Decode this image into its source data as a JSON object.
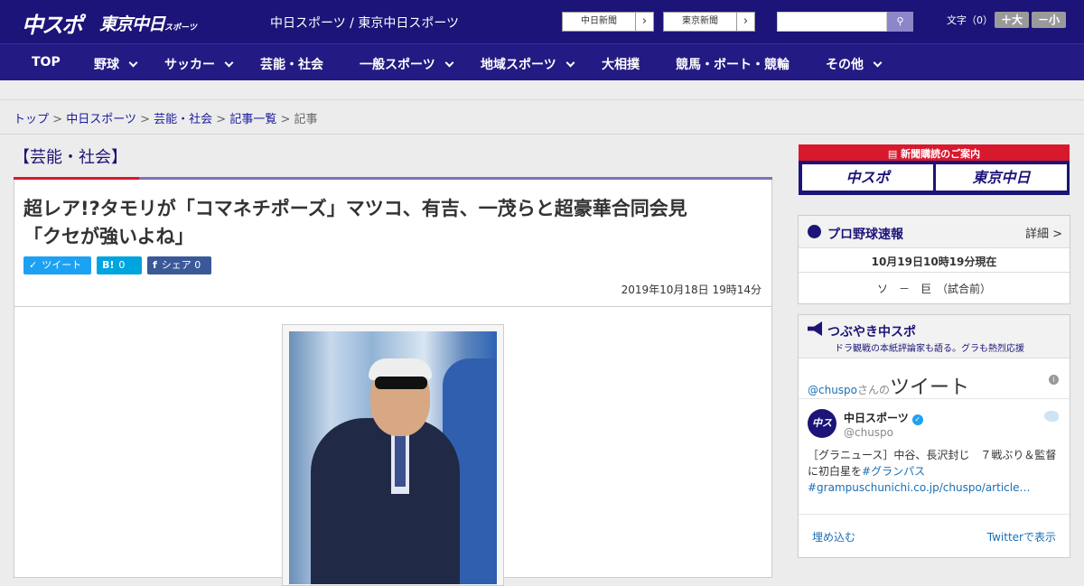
{
  "header": {
    "logo_main": "中スポ",
    "logo_tokyo": "東京中日",
    "logo_tokyo_suffix": "スポーツ",
    "site_title": "中日スポーツ / 東京中日スポーツ",
    "btn_chunichi": "中日新聞",
    "btn_tokyo": "東京新聞",
    "btn_arrow": "›",
    "search_placeholder": "",
    "search_icon_glyph": "⚲",
    "font_size_label": "文字（0）",
    "font_larger": "＋大",
    "font_smaller": "－小"
  },
  "nav": [
    {
      "label": "TOP",
      "dropdown": false
    },
    {
      "label": "野球",
      "dropdown": true
    },
    {
      "label": "サッカー",
      "dropdown": true
    },
    {
      "label": "芸能・社会",
      "dropdown": false
    },
    {
      "label": "一般スポーツ",
      "dropdown": true
    },
    {
      "label": "地域スポーツ",
      "dropdown": true
    },
    {
      "label": "大相撲",
      "dropdown": false
    },
    {
      "label": "競馬・ボート・競輪",
      "dropdown": false
    },
    {
      "label": "その他",
      "dropdown": true
    }
  ],
  "breadcrumb": {
    "items": [
      "トップ",
      "中日スポーツ",
      "芸能・社会",
      "記事一覧"
    ],
    "separator": ">",
    "current": "記事"
  },
  "article": {
    "section": "【芸能・社会】",
    "title_line1": "超レア!?タモリが「コマネチポーズ」マツコ、有吉、一茂らと超豪華合同会見",
    "title_line2": "「クセが強いよね」",
    "share_tweet": "ツイート",
    "share_hatena": "0",
    "share_facebook": "シェア 0",
    "date": "2019年10月18日 19時14分"
  },
  "sidebar": {
    "promo_title": "新聞購読のご案内",
    "promo_btn1": "中スポ",
    "promo_btn2": "東京中日",
    "baseball": {
      "title": "プロ野球速報",
      "detail": "詳細 >",
      "time": "10月19日10時19分現在",
      "score": "ソ　－　巨　（試合前）"
    },
    "twitter": {
      "title": "つぶやき中スポ",
      "subtitle": "ドラ観戦の本紙評論家も語る。グラも熱烈応援",
      "user_handle_link": "@chuspo",
      "user_suffix": "さんの",
      "user_big": "ツイート",
      "avatar_text": "中スポ",
      "name": "中日スポーツ",
      "handle": "@chuspo",
      "text": "［グラニュース］中谷、長沢封じ　７戦ぶり＆監督に初白星を",
      "hashtag": "#グランパス",
      "link": "#grampuschunichi.co.jp/chuspo/article…",
      "embed": "埋め込む",
      "view_on": "Twitterで表示"
    }
  },
  "colors": {
    "header_bg": "#1c1478",
    "accent_red": "#d8182d",
    "twitter_blue": "#1da1f2",
    "hatena_blue": "#00a4de",
    "facebook_blue": "#3b5998"
  }
}
